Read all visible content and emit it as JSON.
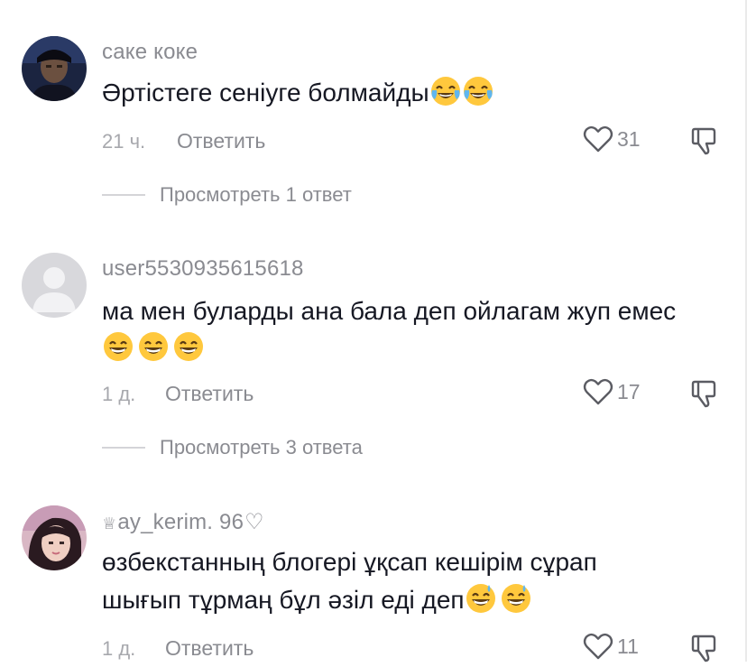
{
  "comments": [
    {
      "username": "саке коке",
      "text": "Әртістеге сеніуге болмайды",
      "time": "21 ч.",
      "reply_label": "Ответить",
      "likes": "31",
      "view_replies": "Просмотреть 1 ответ",
      "avatar": "dark-photo-avatar",
      "emoji": [
        "tears-of-joy",
        "tears-of-joy"
      ]
    },
    {
      "username": "user5530935615618",
      "text": "ма мен буларды ана бала деп ойлагам жуп емес",
      "time": "1 д.",
      "reply_label": "Ответить",
      "likes": "17",
      "view_replies": "Просмотреть 3 ответа",
      "avatar": "default-grey-avatar",
      "emoji": [
        "grinning-smile",
        "grinning-smile",
        "grinning-smile"
      ]
    },
    {
      "username": "ay_kerim. 96",
      "username_prefix_icon": "crown-icon",
      "username_suffix_icon": "heart-outline-icon",
      "text_line1": "өзбекстанның блогері ұқсап кешірім сұрап",
      "text_line2": "шығып тұрмаң бұл әзіл еді деп",
      "time": "1 д.",
      "reply_label": "Ответить",
      "likes": "11",
      "avatar": "pink-photo-avatar",
      "emoji": [
        "grinning-sweat",
        "grinning-sweat"
      ]
    }
  ],
  "colors": {
    "text": "#161823",
    "secondary": "#8a8b91",
    "muted": "#a7a8ad",
    "emoji_yellow": "#FFC83D"
  }
}
